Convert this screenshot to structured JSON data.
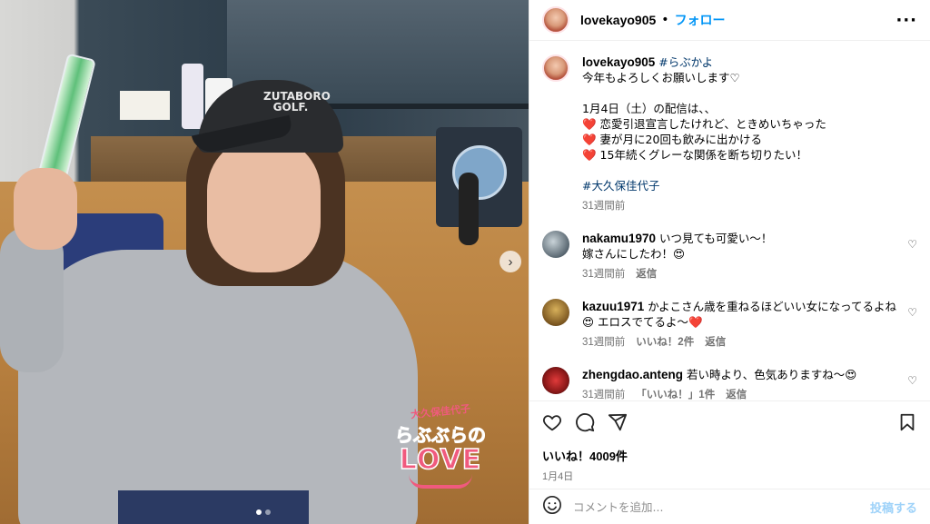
{
  "post": {
    "username": "lovekayo905",
    "separator": "•",
    "follow_label": "フォロー",
    "more_label": "···",
    "image": {
      "cap_text": "ZUTABORO GOLF.",
      "logo_line1": "大久保佳代子",
      "logo_line2": "らぶぶらの",
      "logo_line3": "LOVE",
      "next_label": "›"
    }
  },
  "caption": {
    "username": "lovekayo905",
    "hashtag": "#らぶかよ",
    "lines": [
      "今年もよろしくお願いします♡",
      "",
      "1月4日（土）の配信は、、",
      "❤️ 恋愛引退宣言したけれど、ときめいちゃった",
      "❤️ 妻が月に20回も飲みに出かける",
      "❤️ 15年続くグレーな関係を断ち切りたい！",
      ""
    ],
    "hashtag2": "#大久保佳代子",
    "time": "31週間前"
  },
  "comments": [
    {
      "username": "nakamu1970",
      "text": "いつ見ても可愛い〜！",
      "text2": "嫁さんにしたわ！😍",
      "time": "31週間前",
      "likes": "",
      "reply": "返信"
    },
    {
      "username": "kazuu1971",
      "text": "かよこさん歳を重ねるほどいい女になってるよね",
      "text2": "😍 エロスでてるよ〜❤️",
      "time": "31週間前",
      "likes": "いいね！2件",
      "reply": "返信"
    },
    {
      "username": "zhengdao.anteng",
      "text": "若い時より、色気ありますね〜😍",
      "text2": "",
      "time": "31週間前",
      "likes": "「いいね！」1件",
      "reply": "返信"
    }
  ],
  "actions": {
    "likes_text": "いいね！4009件",
    "date": "1月4日"
  },
  "add_comment": {
    "placeholder": "コメントを追加...",
    "post_label": "投稿する"
  },
  "colors": {
    "link": "#0095f6",
    "hashtag": "#00376b",
    "muted": "#737373",
    "brand_pink": "#f05a7e"
  },
  "icons": [
    "heart-icon",
    "comment-icon",
    "share-icon",
    "bookmark-icon",
    "emoji-icon",
    "chevron-right-icon",
    "more-icon"
  ]
}
